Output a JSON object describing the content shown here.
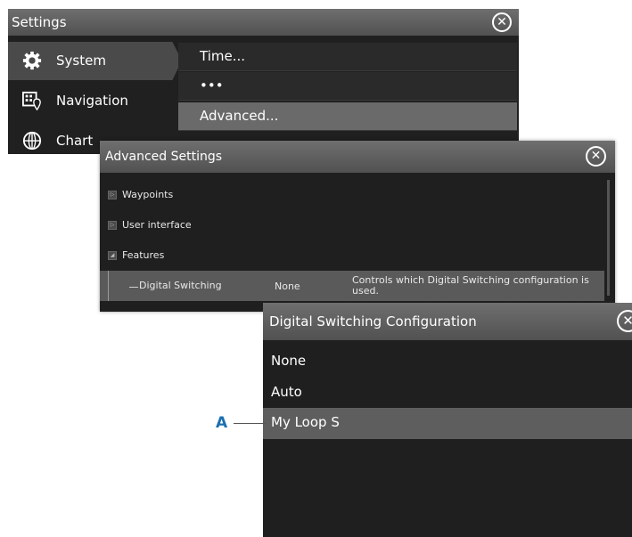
{
  "settings": {
    "title": "Settings",
    "close_glyph": "✕",
    "left_items": [
      {
        "label": "System",
        "icon": "gear-icon",
        "selected": true
      },
      {
        "label": "Navigation",
        "icon": "navigation-icon"
      },
      {
        "label": "Chart",
        "icon": "globe-icon"
      }
    ],
    "right_items": [
      {
        "label": "Time..."
      },
      {
        "label": "•••"
      },
      {
        "label": "Advanced...",
        "selected": true
      }
    ]
  },
  "advanced": {
    "title": "Advanced Settings",
    "close_glyph": "✕",
    "tree": [
      {
        "label": "Waypoints",
        "expander": "▷"
      },
      {
        "label": "User interface",
        "expander": "▷"
      },
      {
        "label": "Features",
        "expander": "◢"
      }
    ],
    "selected_row": {
      "label": "Digital Switching",
      "value": "None",
      "description": "Controls which Digital Switching configuration is used."
    }
  },
  "dsconfig": {
    "title": "Digital Switching Configuration",
    "close_glyph": "✕",
    "options": [
      {
        "label": "None"
      },
      {
        "label": "Auto"
      },
      {
        "label": "My Loop S",
        "selected": true
      }
    ]
  },
  "callout": {
    "label": "A"
  },
  "colors": {
    "selected": "#5a5a5a",
    "callout": "#1a6fb0",
    "titlebar": "#606060"
  }
}
